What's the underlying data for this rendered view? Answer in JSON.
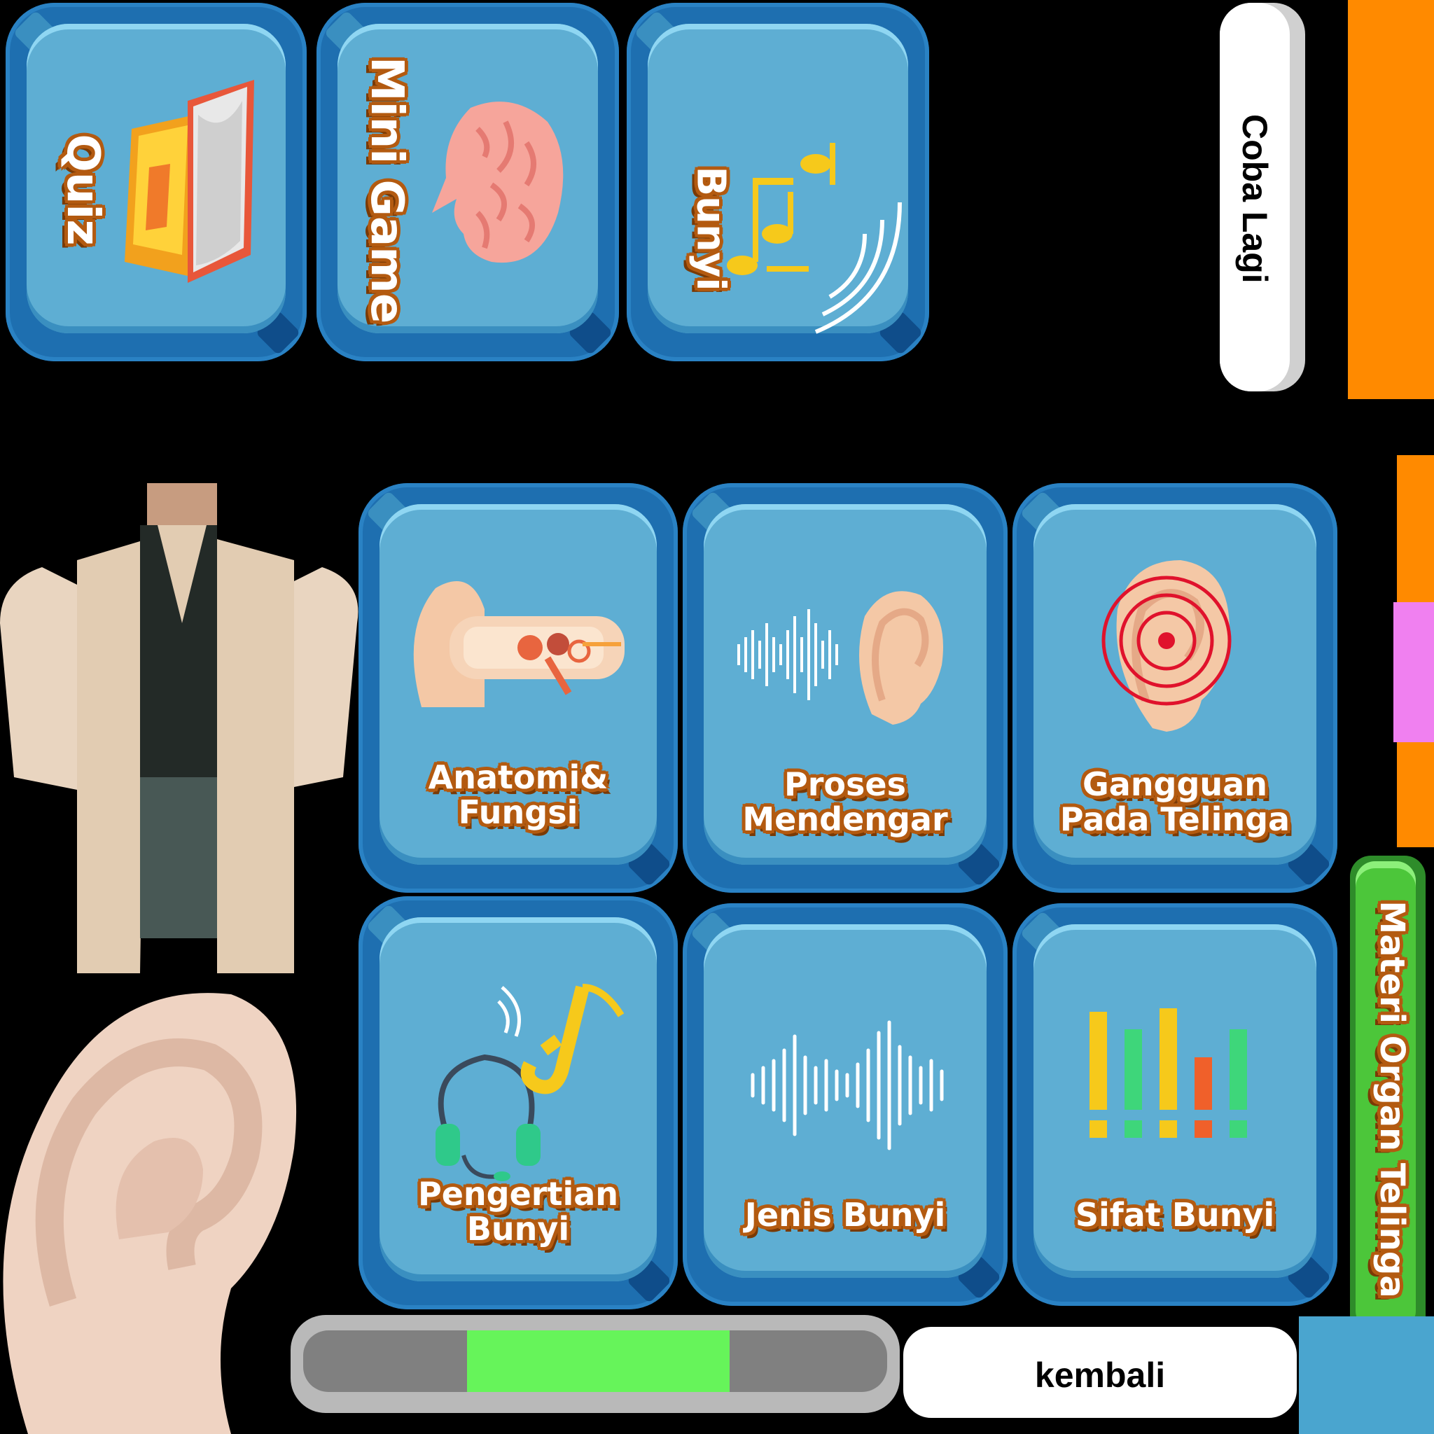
{
  "top_tiles": [
    {
      "label": "Quiz",
      "icon": "book-icon"
    },
    {
      "label": "Mini Game",
      "icon": "brain-icon"
    },
    {
      "label": "Bunyi",
      "icon": "music-note-icon"
    }
  ],
  "side_buttons": {
    "retry_label": "Coba Lagi",
    "materi_label": "Materi Organ Telinga",
    "back_label": "kembali"
  },
  "menu_cards": [
    {
      "label_line1": "Anatomi&",
      "label_line2": "Fungsi",
      "icon": "ear-anatomy-icon"
    },
    {
      "label_line1": "Proses",
      "label_line2": "Mendengar",
      "icon": "ear-soundwave-icon"
    },
    {
      "label_line1": "Gangguan",
      "label_line2": "Pada Telinga",
      "icon": "ear-target-icon"
    },
    {
      "label_line1": "Pengertian",
      "label_line2": "Bunyi",
      "icon": "headphones-saxophone-icon"
    },
    {
      "label_line1": "Jenis Bunyi",
      "label_line2": "",
      "icon": "soundwave-icon"
    },
    {
      "label_line1": "Sifat Bunyi",
      "label_line2": "",
      "icon": "equalizer-icon"
    }
  ],
  "progress": {
    "segment_start": 0.28,
    "segment_end": 0.73
  },
  "colors": {
    "tile_blue": "#5eaed3",
    "tile_dark": "#1e6fb0",
    "label_outline": "#b35a10",
    "orange_accent": "#ff8a00",
    "green_button": "#4cc63a",
    "progress_green": "#66f45a",
    "progress_gray": "#808080"
  }
}
